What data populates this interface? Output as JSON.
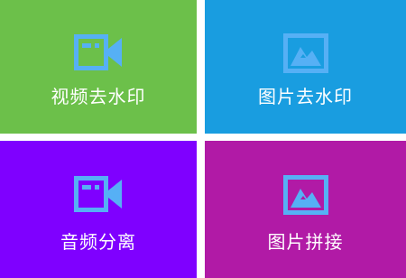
{
  "tiles": [
    {
      "label": "视频去水印",
      "color": "#6cc04a",
      "icon": "video-camera-icon"
    },
    {
      "label": "图片去水印",
      "color": "#199de0",
      "icon": "image-icon"
    },
    {
      "label": "音频分离",
      "color": "#7f00ff",
      "icon": "video-camera-icon"
    },
    {
      "label": "图片拼接",
      "color": "#b11aa6",
      "icon": "image-icon"
    }
  ],
  "colors": {
    "icon_fill": "#56b0f5",
    "icon_dark": "#2f8ae0"
  }
}
